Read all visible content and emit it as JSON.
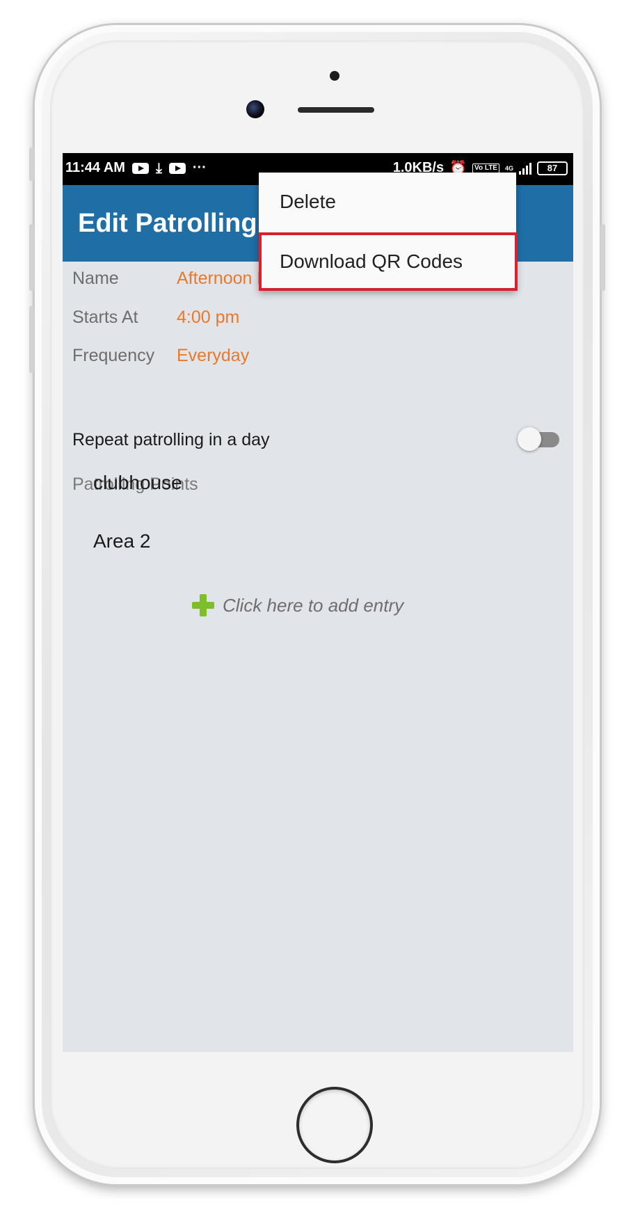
{
  "status_bar": {
    "time": "11:44 AM",
    "more": "···",
    "net_speed": "1.0KB/s",
    "volte": "Vo LTE",
    "network": "4G",
    "battery": "87"
  },
  "app_bar": {
    "title": "Edit Patrolling"
  },
  "menu": {
    "items": [
      {
        "label": "Delete"
      },
      {
        "label": "Download QR Codes",
        "highlighted": true
      }
    ],
    "highlight_color": "#d9202b"
  },
  "form": {
    "name": {
      "label": "Name",
      "value": "Afternoon Pa"
    },
    "starts_at": {
      "label": "Starts At",
      "value": "4:00 pm"
    },
    "frequency": {
      "label": "Frequency",
      "value": "Everyday"
    },
    "repeat": {
      "label": "Repeat patrolling in a day",
      "enabled": false
    }
  },
  "patrolling_points": {
    "label": "Patrolling Points",
    "items": [
      "clubhouse",
      "Area 2"
    ],
    "add_entry_label": "Click here to add entry"
  },
  "colors": {
    "app_bar": "#1f6fa6",
    "accent_value": "#e8792b",
    "add_icon": "#7cbf2b",
    "screen_bg": "#e1e4e8"
  }
}
